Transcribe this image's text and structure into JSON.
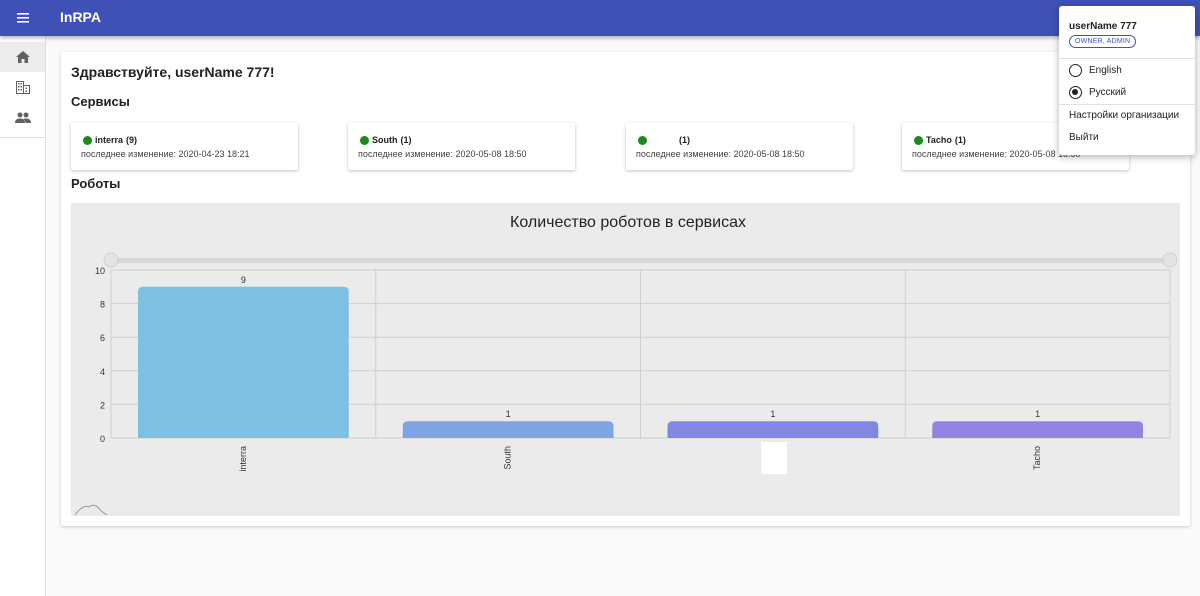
{
  "app": {
    "title": "InRPA"
  },
  "greeting": "Здравствуйте, userName 777!",
  "sections": {
    "services": "Сервисы",
    "robots": "Роботы"
  },
  "services": [
    {
      "name": "interra",
      "count": "(9)",
      "status_color": "#1a8a1a",
      "subtitle": "последнее изменение: 2020-04-23 18:21"
    },
    {
      "name": "South",
      "count": "(1)",
      "status_color": "#1a8a1a",
      "subtitle": "последнее изменение: 2020-05-08 18:50"
    },
    {
      "name": "",
      "count": "(1)",
      "status_color": "#1a8a1a",
      "subtitle": "последнее изменение: 2020-05-08 18:50"
    },
    {
      "name": "Tacho",
      "count": "(1)",
      "status_color": "#1a8a1a",
      "subtitle": "последнее изменение: 2020-05-08 18:50"
    }
  ],
  "user_menu": {
    "username": "userName 777",
    "roles": "OWNER, ADMIN",
    "languages": [
      {
        "label": "English",
        "selected": false
      },
      {
        "label": "Русский",
        "selected": true
      }
    ],
    "org_settings": "Настройки организации",
    "logout": "Выйти"
  },
  "icons": {
    "menu": "menu-icon",
    "home": "home-icon",
    "organization": "business-icon",
    "users": "people-icon"
  },
  "colors": {
    "appbar": "#3f51b5",
    "status_ok": "#1a8a1a",
    "chart_bg": "#ebebeb"
  },
  "chart_data": {
    "type": "bar",
    "title": "Количество роботов в сервисах",
    "categories": [
      "interra",
      "South",
      "",
      "Tacho"
    ],
    "values": [
      9,
      1,
      1,
      1
    ],
    "bar_colors": [
      "#7ec0e2",
      "#80a3e3",
      "#8088e3",
      "#9184e2"
    ],
    "ylim": [
      0,
      10
    ],
    "yticks": [
      0,
      2,
      4,
      6,
      8,
      10
    ],
    "grid": true,
    "data_labels": true
  }
}
